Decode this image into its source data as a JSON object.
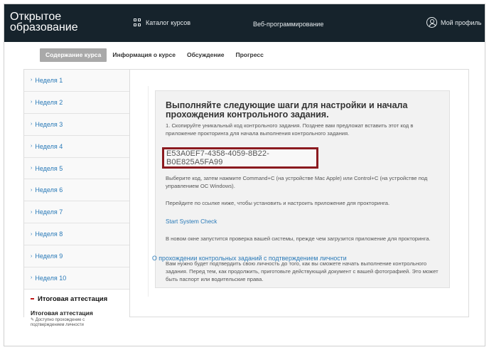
{
  "header": {
    "logo_line1": "Открытое",
    "logo_line2": "образование",
    "catalog_label": "Каталог курсов",
    "center_label": "Веб-программирование",
    "profile_label": "Мой профиль"
  },
  "tabs": [
    {
      "label": "Содержание курса",
      "active": true
    },
    {
      "label": "Информация о курсе",
      "active": false
    },
    {
      "label": "Обсуждение",
      "active": false
    },
    {
      "label": "Прогресс",
      "active": false
    }
  ],
  "sidebar": {
    "weeks": [
      "Неделя 1",
      "Неделя 2",
      "Неделя 3",
      "Неделя 4",
      "Неделя 5",
      "Неделя 6",
      "Неделя 7",
      "Неделя 8",
      "Неделя 9",
      "Неделя 10"
    ],
    "final_heading": "Итоговая аттестация",
    "final_item": "Итоговая аттестация",
    "final_note": "Доступно прохождение с подтверждением личности"
  },
  "main": {
    "title": "Выполняйте следующие шаги для настройки и начала прохождения контрольного задания.",
    "step1": "1. Скопируйте уникальный код контрольного задания. Позднее вам предложат вставить этот код в приложение прокторинга для начала выполнения контрольного задания.",
    "code": "E53A0EF7-4358-4059-8B22-B0E825A5FA99",
    "copy_hint": "Выберите код, затем нажмите Command+C (на устройстве Mac Apple) или Control+C (на устройстве под управлением ОС Windows).",
    "install_hint": "Перейдите по ссылке ниже, чтобы установить и настроить приложение для прокторинга.",
    "system_check_link": "Start System Check",
    "check_note": "В новом окне запустится проверка вашей системы, прежде чем загрузится приложение для прокторинга.",
    "id_note": "Вам нужно будет подтвердить свою личность до того, как вы сможете начать выполнение контрольного задания. Перед тем, как продолжить, приготовьте действующий документ с вашей фотографией. Это может быть паспорт или водительские права.",
    "bottom_link": "О прохождении контрольных заданий с подтверждением личности"
  },
  "colors": {
    "header_bg": "#16232c",
    "link": "#2a7ab8",
    "code_border": "#8b1a1f",
    "active_tab": "#a9a9a9"
  }
}
